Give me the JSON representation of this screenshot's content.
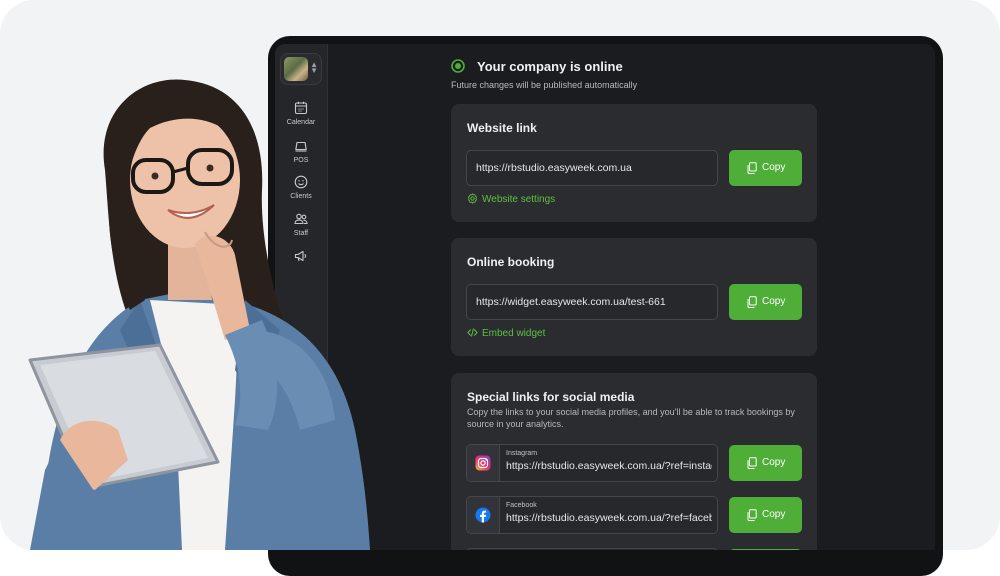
{
  "sidebar": {
    "items": [
      {
        "label": "Calendar",
        "icon": "calendar-icon"
      },
      {
        "label": "POS",
        "icon": "register-icon"
      },
      {
        "label": "Clients",
        "icon": "smiley-icon"
      },
      {
        "label": "Staff",
        "icon": "people-icon"
      },
      {
        "label": "",
        "icon": "megaphone-icon"
      }
    ]
  },
  "status": {
    "title": "Your company is online",
    "subtitle": "Future changes will be published automatically",
    "color": "#4eae38"
  },
  "website": {
    "title": "Website link",
    "url": "https://rbstudio.easyweek.com.ua",
    "copy_label": "Copy",
    "settings_label": "Website settings"
  },
  "booking": {
    "title": "Online booking",
    "url": "https://widget.easyweek.com.ua/test-661",
    "copy_label": "Copy",
    "embed_label": "Embed widget"
  },
  "social": {
    "title": "Special links for social media",
    "description": "Copy the links to your social media profiles, and you'll be able to track bookings by source in your analytics.",
    "items": [
      {
        "label": "Instagram",
        "url": "https://rbstudio.easyweek.com.ua/?ref=instagram",
        "copy_label": "Copy",
        "icon": "instagram-icon"
      },
      {
        "label": "Facebook",
        "url": "https://rbstudio.easyweek.com.ua/?ref=facebook",
        "copy_label": "Copy",
        "icon": "facebook-icon"
      }
    ]
  },
  "colors": {
    "accent": "#4eae38",
    "screen_bg": "#1b1c1f",
    "panel_bg": "#2b2c30",
    "sidebar_bg": "#25262a",
    "page_bg": "#f2f3f5"
  }
}
